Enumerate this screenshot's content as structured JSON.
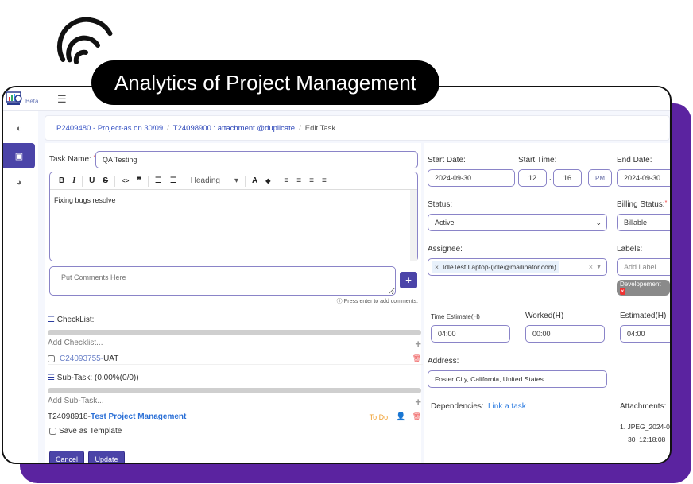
{
  "overlay": {
    "title": "Analytics of Project Management",
    "icon": "signal-waves-icon"
  },
  "app": {
    "beta_label": "Beta",
    "menu_icon": "hamburger-icon"
  },
  "sidebar": {
    "items": [
      {
        "name": "dashboard",
        "icon": "gauge-icon",
        "active": false
      },
      {
        "name": "projects",
        "icon": "briefcase-icon",
        "active": true
      },
      {
        "name": "reports",
        "icon": "pie-chart-icon",
        "active": false
      }
    ]
  },
  "breadcrumb": {
    "project": "P2409480 - Project-as on 30/09",
    "task": "T24098900 : attachment @duplicate",
    "current": "Edit Task",
    "separator": "/"
  },
  "form": {
    "task_name_label": "Task Name:",
    "task_name_value": "QA Testing",
    "toolbar": {
      "bold": "B",
      "italic": "I",
      "underline": "U",
      "strike": "S",
      "code": "<>",
      "quote": "❞",
      "ordered_list": "☰",
      "bullet_list": "☰",
      "heading": "Heading",
      "heading_caret": "▾",
      "font_color": "A",
      "fill": "◆",
      "align_left": "≡",
      "align_center": "≡",
      "align_right": "≡",
      "align_justify": "≡"
    },
    "description": "Fixing bugs resolve",
    "comment_placeholder": "Put Comments Here",
    "comment_add": "+",
    "comment_hint": "Press enter to add comments.",
    "checklist": {
      "title": "CheckList:",
      "add_placeholder": "Add Checklist...",
      "progress": 0,
      "items": [
        {
          "id": "C24093755",
          "sep": " - ",
          "text": "UAT",
          "checked": false
        }
      ]
    },
    "subtask": {
      "title": "Sub-Task: (0.00%(0/0))",
      "add_placeholder": "Add Sub-Task...",
      "progress": 0,
      "items": [
        {
          "id": "T24098918",
          "sep": " - ",
          "text": "Test Project Management",
          "status": "To Do"
        }
      ]
    },
    "save_template_label": "Save as Template",
    "cancel_label": "Cancel",
    "update_label": "Update"
  },
  "details": {
    "start_date_label": "Start Date:",
    "start_date": "2024-09-30",
    "start_time_label": "Start Time:",
    "start_hour": "12",
    "start_min": "16",
    "time_sep": ":",
    "ampm": "PM",
    "end_date_label": "End Date:",
    "end_date": "2024-09-30",
    "status_label": "Status:",
    "status_value": "Active",
    "billing_label": "Billing Status:",
    "billing_value": "Billable",
    "assignee_label": "Assignee:",
    "assignee_value": "IdleTest Laptop-(idle@mailinator.com)",
    "labels_label": "Labels:",
    "labels_placeholder": "Add Label",
    "label_tags": [
      "Developement"
    ],
    "time_estimate_label": "Time Estimate(H)",
    "time_estimate": "04:00",
    "worked_label": "Worked(H)",
    "worked": "00:00",
    "estimated_label": "Estimated(H)",
    "estimated": "04:00",
    "address_label": "Address:",
    "address": "Foster City, California, United States",
    "dependencies_label": "Dependencies:",
    "dependencies_link": "Link a task",
    "attachments_label": "Attachments:",
    "attachment_line1": "1. JPEG_2024-0",
    "attachment_line2": "30_12:18:08_"
  },
  "colors": {
    "accent": "#4b44a8",
    "background_purple": "#5b23a0",
    "link": "#3a56c5",
    "todo": "#f0a030",
    "danger": "#e55555"
  }
}
